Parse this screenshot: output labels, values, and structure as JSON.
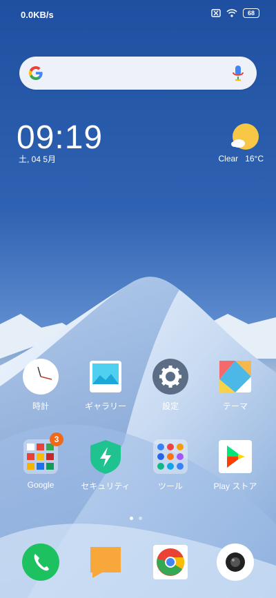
{
  "status_bar": {
    "net_speed": "0.0KB/s",
    "battery": "68"
  },
  "search_bar": {},
  "clock_widget": {
    "time": "09:19",
    "date": "土, 04 5月"
  },
  "weather_widget": {
    "condition": "Clear",
    "temp": "16°C"
  },
  "apps_row1": [
    {
      "label": "時計",
      "icon": "clock-icon"
    },
    {
      "label": "ギャラリー",
      "icon": "gallery-icon"
    },
    {
      "label": "設定",
      "icon": "settings-icon"
    },
    {
      "label": "テーマ",
      "icon": "themes-icon"
    }
  ],
  "apps_row2": [
    {
      "label": "Google",
      "icon": "google-folder-icon",
      "badge": "3"
    },
    {
      "label": "セキュリティ",
      "icon": "security-icon"
    },
    {
      "label": "ツール",
      "icon": "tools-folder-icon"
    },
    {
      "label": "Play ストア",
      "icon": "play-store-icon"
    }
  ],
  "dock": [
    {
      "icon": "phone-icon"
    },
    {
      "icon": "messages-icon"
    },
    {
      "icon": "chrome-icon"
    },
    {
      "icon": "camera-icon"
    }
  ],
  "colors": {
    "accent_blue": "#2a5aa8",
    "phone_green": "#1ec15f",
    "badge_orange": "#f06a1a"
  }
}
